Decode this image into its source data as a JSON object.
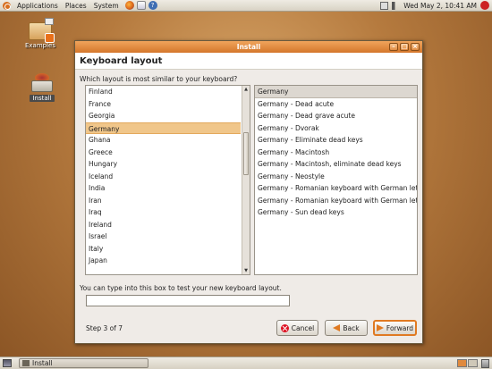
{
  "top_panel": {
    "menus": [
      "Applications",
      "Places",
      "System"
    ],
    "clock": "Wed May  2, 10:41 AM"
  },
  "desktop": {
    "icons": [
      "Examples",
      "Install"
    ]
  },
  "window": {
    "title": "Install",
    "heading": "Keyboard layout",
    "question": "Which layout is most similar to your keyboard?",
    "countries": [
      "Finland",
      "France",
      "Georgia",
      "Germany",
      "Ghana",
      "Greece",
      "Hungary",
      "Iceland",
      "India",
      "Iran",
      "Iraq",
      "Ireland",
      "Israel",
      "Italy",
      "Japan"
    ],
    "selected_country": "Germany",
    "variants": [
      "Germany",
      "Germany - Dead acute",
      "Germany - Dead grave acute",
      "Germany - Dvorak",
      "Germany - Eliminate dead keys",
      "Germany - Macintosh",
      "Germany - Macintosh, eliminate dead keys",
      "Germany - Neostyle",
      "Germany - Romanian keyboard with German letters",
      "Germany - Romanian keyboard with German letters,",
      "Germany - Sun dead keys"
    ],
    "test_label": "You can type into this box to test your new keyboard layout.",
    "test_value": "",
    "step": "Step 3 of 7",
    "buttons": {
      "cancel": "Cancel",
      "back": "Back",
      "forward": "Forward"
    }
  },
  "taskbar": {
    "task": "Install"
  },
  "colors": {
    "accent": "#e07a22",
    "selection": "#f0c68a",
    "title_bar": "#d5772b"
  }
}
